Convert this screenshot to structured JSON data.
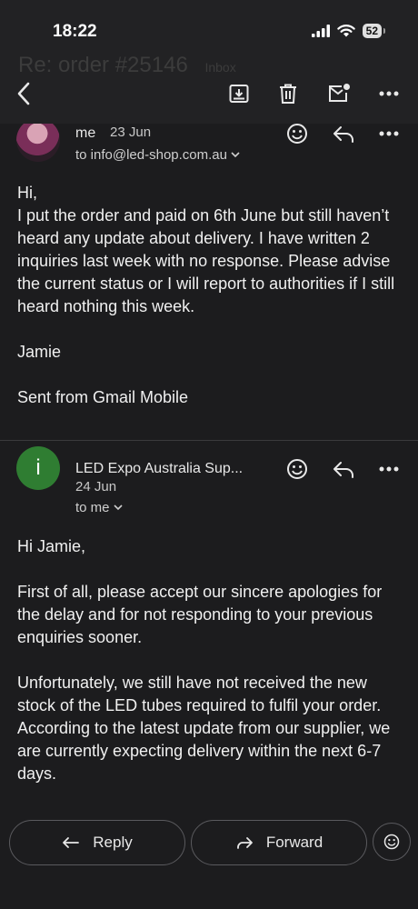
{
  "status": {
    "time": "18:22",
    "battery": "52"
  },
  "toolbar": {
    "ghost_subject": "Re: order #25146",
    "ghost_label": "Inbox",
    "back_icon": "arrow-left-icon",
    "archive_icon": "archive-icon",
    "delete_icon": "trash-icon",
    "unread_icon": "mark-unread-icon",
    "more_icon": "more-horizontal-icon"
  },
  "messages": [
    {
      "sender": "me",
      "date": "23 Jun",
      "recipient": "to info@led-shop.com.au",
      "body": [
        "Hi,",
        "I put the order and paid on 6th June but still haven’t heard any update about delivery. I have written 2 inquiries last week with no response. Please advise the current status or I will report to authorities if I still heard nothing this week.",
        "",
        "Jamie",
        "",
        "Sent from Gmail Mobile"
      ]
    },
    {
      "avatar_letter": "i",
      "sender": "LED Expo Australia Sup...",
      "date": "24 Jun",
      "recipient": "to me",
      "body": [
        "Hi Jamie,",
        "",
        "First of all, please accept our sincere apologies for the delay and for not responding to your previous enquiries sooner.",
        "",
        "Unfortunately, we still have not received the new stock of the LED tubes required to fulfil your order.",
        "According to the latest update from our supplier, we are currently expecting delivery within the next 6-7 days."
      ]
    }
  ],
  "actions": {
    "reply": "Reply",
    "forward": "Forward"
  },
  "colors": {
    "background": "#1c1c1e",
    "toolbar": "#222224",
    "avatar_green": "#2f7d32",
    "text": "#f0f0f0"
  }
}
